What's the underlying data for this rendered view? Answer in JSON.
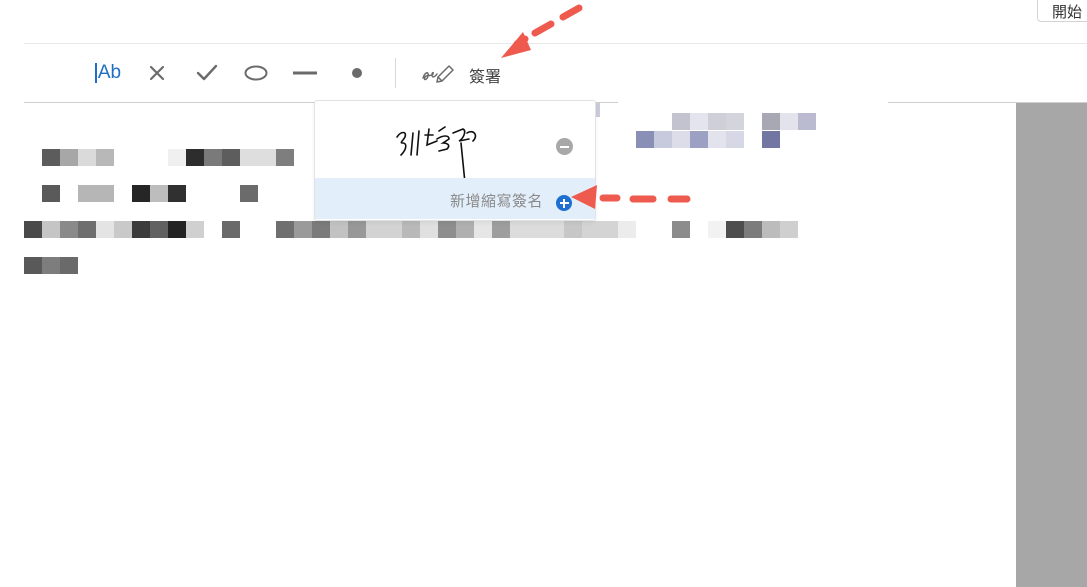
{
  "header": {
    "start_button_label": "開始"
  },
  "toolbar": {
    "text_tool_label": "Ab",
    "sign_label": "簽署",
    "icons": [
      "text-tool-icon",
      "cross-icon",
      "check-icon",
      "ellipse-icon",
      "line-icon",
      "dot-icon",
      "sign-pen-icon"
    ]
  },
  "sign_menu": {
    "add_initials_label": "新增縮寫簽名",
    "remove_icon": "minus-circle-icon",
    "add_icon": "plus-circle-icon"
  },
  "annotations": {
    "arrow_color": "#f2554a",
    "accent_color": "#1d6fd1"
  }
}
